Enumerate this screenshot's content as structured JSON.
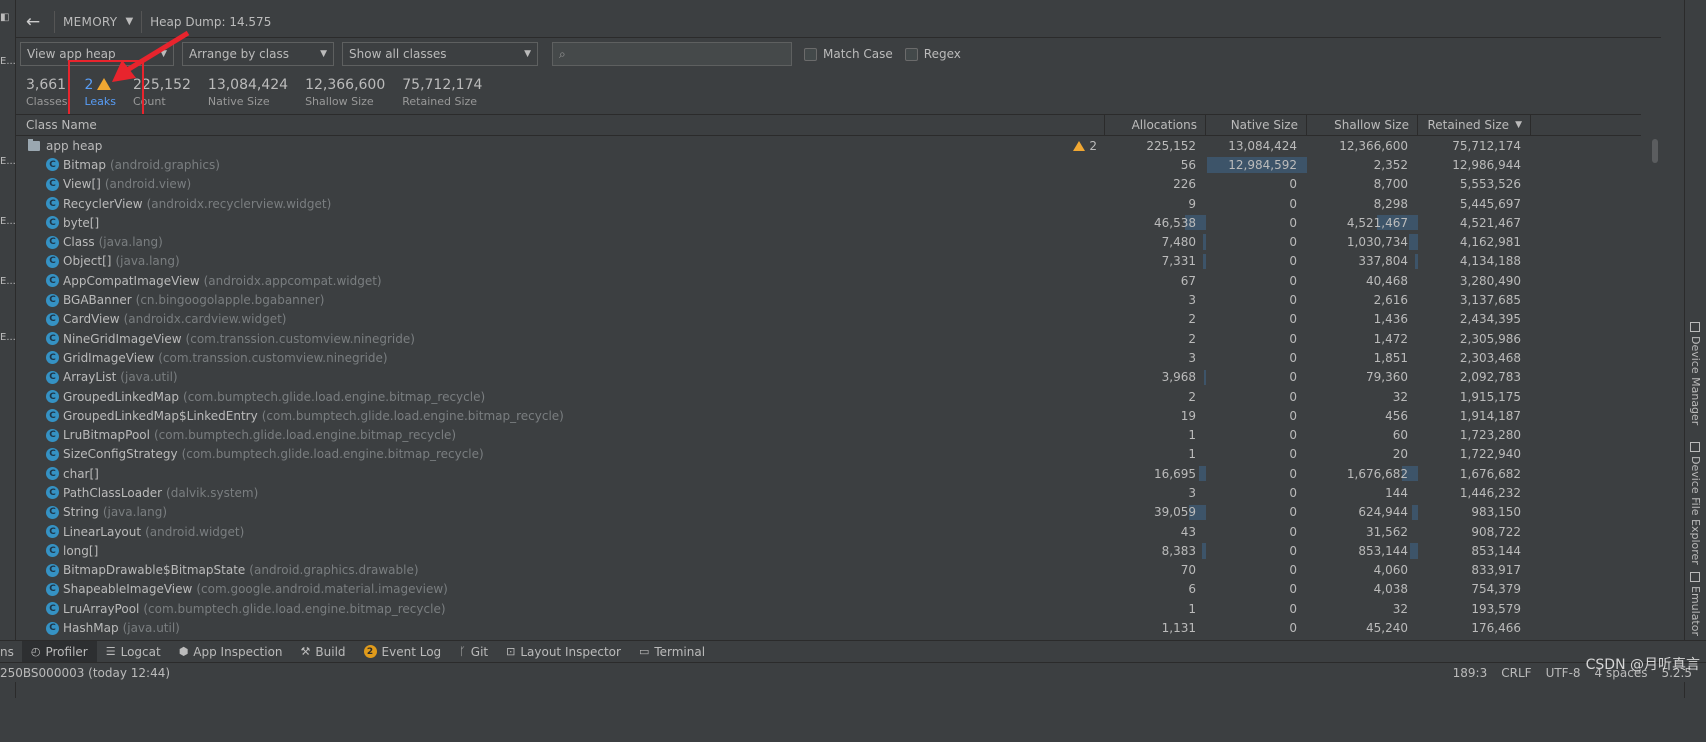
{
  "topbar": {
    "profiler_label": "MEMORY",
    "heap_dump_label": "Heap Dump: 14.575"
  },
  "filters": {
    "heap_select": "View app heap",
    "arrange_select": "Arrange by class",
    "show_select": "Show all classes",
    "search_placeholder": "",
    "match_case_label": "Match Case",
    "regex_label": "Regex"
  },
  "summary": {
    "classes": {
      "value": "3,661",
      "label": "Classes"
    },
    "leaks": {
      "value": "2",
      "label": "Leaks"
    },
    "count": {
      "value": "225,152",
      "label": "Count"
    },
    "native_size": {
      "value": "13,084,424",
      "label": "Native Size"
    },
    "shallow_size": {
      "value": "12,366,600",
      "label": "Shallow Size"
    },
    "retained_size": {
      "value": "75,712,174",
      "label": "Retained Size"
    }
  },
  "table": {
    "columns": [
      "Class Name",
      "Allocations",
      "Native Size",
      "Shallow Size",
      "Retained Size"
    ],
    "root": {
      "name": "app heap",
      "leaks": "2",
      "allocations": "225,152",
      "native": "13,084,424",
      "shallow": "12,366,600",
      "retained": "75,712,174"
    },
    "rows": [
      {
        "name": "Bitmap",
        "pkg": "(android.graphics)",
        "allocations": "56",
        "native": "12,984,592",
        "shallow": "2,352",
        "retained": "12,986,944",
        "native_bar": 0.99,
        "alloc_bar": 0,
        "shallow_bar": 0
      },
      {
        "name": "View[]",
        "pkg": "(android.view)",
        "allocations": "226",
        "native": "0",
        "shallow": "8,700",
        "retained": "5,553,526",
        "native_bar": 0,
        "alloc_bar": 0,
        "shallow_bar": 0
      },
      {
        "name": "RecyclerView",
        "pkg": "(androidx.recyclerview.widget)",
        "allocations": "9",
        "native": "0",
        "shallow": "8,298",
        "retained": "5,445,697",
        "native_bar": 0,
        "alloc_bar": 0,
        "shallow_bar": 0
      },
      {
        "name": "byte[]",
        "pkg": "",
        "allocations": "46,538",
        "native": "0",
        "shallow": "4,521,467",
        "retained": "4,521,467",
        "native_bar": 0,
        "alloc_bar": 0.21,
        "shallow_bar": 0.37
      },
      {
        "name": "Class",
        "pkg": "(java.lang)",
        "allocations": "7,480",
        "native": "0",
        "shallow": "1,030,734",
        "retained": "4,162,981",
        "native_bar": 0,
        "alloc_bar": 0.03,
        "shallow_bar": 0.08
      },
      {
        "name": "Object[]",
        "pkg": "(java.lang)",
        "allocations": "7,331",
        "native": "0",
        "shallow": "337,804",
        "retained": "4,134,188",
        "native_bar": 0,
        "alloc_bar": 0.03,
        "shallow_bar": 0.03
      },
      {
        "name": "AppCompatImageView",
        "pkg": "(androidx.appcompat.widget)",
        "allocations": "67",
        "native": "0",
        "shallow": "40,468",
        "retained": "3,280,490",
        "native_bar": 0,
        "alloc_bar": 0,
        "shallow_bar": 0
      },
      {
        "name": "BGABanner",
        "pkg": "(cn.bingoogolapple.bgabanner)",
        "allocations": "3",
        "native": "0",
        "shallow": "2,616",
        "retained": "3,137,685",
        "native_bar": 0,
        "alloc_bar": 0,
        "shallow_bar": 0
      },
      {
        "name": "CardView",
        "pkg": "(androidx.cardview.widget)",
        "allocations": "2",
        "native": "0",
        "shallow": "1,436",
        "retained": "2,434,395",
        "native_bar": 0,
        "alloc_bar": 0,
        "shallow_bar": 0
      },
      {
        "name": "NineGridImageView",
        "pkg": "(com.transsion.customview.ninegride)",
        "allocations": "2",
        "native": "0",
        "shallow": "1,472",
        "retained": "2,305,986",
        "native_bar": 0,
        "alloc_bar": 0,
        "shallow_bar": 0
      },
      {
        "name": "GridImageView",
        "pkg": "(com.transsion.customview.ninegride)",
        "allocations": "3",
        "native": "0",
        "shallow": "1,851",
        "retained": "2,303,468",
        "native_bar": 0,
        "alloc_bar": 0,
        "shallow_bar": 0
      },
      {
        "name": "ArrayList",
        "pkg": "(java.util)",
        "allocations": "3,968",
        "native": "0",
        "shallow": "79,360",
        "retained": "2,092,783",
        "native_bar": 0,
        "alloc_bar": 0.02,
        "shallow_bar": 0
      },
      {
        "name": "GroupedLinkedMap",
        "pkg": "(com.bumptech.glide.load.engine.bitmap_recycle)",
        "allocations": "2",
        "native": "0",
        "shallow": "32",
        "retained": "1,915,175",
        "native_bar": 0,
        "alloc_bar": 0,
        "shallow_bar": 0
      },
      {
        "name": "GroupedLinkedMap$LinkedEntry",
        "pkg": "(com.bumptech.glide.load.engine.bitmap_recycle)",
        "allocations": "19",
        "native": "0",
        "shallow": "456",
        "retained": "1,914,187",
        "native_bar": 0,
        "alloc_bar": 0,
        "shallow_bar": 0
      },
      {
        "name": "LruBitmapPool",
        "pkg": "(com.bumptech.glide.load.engine.bitmap_recycle)",
        "allocations": "1",
        "native": "0",
        "shallow": "60",
        "retained": "1,723,280",
        "native_bar": 0,
        "alloc_bar": 0,
        "shallow_bar": 0
      },
      {
        "name": "SizeConfigStrategy",
        "pkg": "(com.bumptech.glide.load.engine.bitmap_recycle)",
        "allocations": "1",
        "native": "0",
        "shallow": "20",
        "retained": "1,722,940",
        "native_bar": 0,
        "alloc_bar": 0,
        "shallow_bar": 0
      },
      {
        "name": "char[]",
        "pkg": "",
        "allocations": "16,695",
        "native": "0",
        "shallow": "1,676,682",
        "retained": "1,676,682",
        "native_bar": 0,
        "alloc_bar": 0.07,
        "shallow_bar": 0.14
      },
      {
        "name": "PathClassLoader",
        "pkg": "(dalvik.system)",
        "allocations": "3",
        "native": "0",
        "shallow": "144",
        "retained": "1,446,232",
        "native_bar": 0,
        "alloc_bar": 0,
        "shallow_bar": 0
      },
      {
        "name": "String",
        "pkg": "(java.lang)",
        "allocations": "39,059",
        "native": "0",
        "shallow": "624,944",
        "retained": "983,150",
        "native_bar": 0,
        "alloc_bar": 0.17,
        "shallow_bar": 0.05
      },
      {
        "name": "LinearLayout",
        "pkg": "(android.widget)",
        "allocations": "43",
        "native": "0",
        "shallow": "31,562",
        "retained": "908,722",
        "native_bar": 0,
        "alloc_bar": 0,
        "shallow_bar": 0
      },
      {
        "name": "long[]",
        "pkg": "",
        "allocations": "8,383",
        "native": "0",
        "shallow": "853,144",
        "retained": "853,144",
        "native_bar": 0,
        "alloc_bar": 0.04,
        "shallow_bar": 0.07
      },
      {
        "name": "BitmapDrawable$BitmapState",
        "pkg": "(android.graphics.drawable)",
        "allocations": "70",
        "native": "0",
        "shallow": "4,060",
        "retained": "833,917",
        "native_bar": 0,
        "alloc_bar": 0,
        "shallow_bar": 0
      },
      {
        "name": "ShapeableImageView",
        "pkg": "(com.google.android.material.imageview)",
        "allocations": "6",
        "native": "0",
        "shallow": "4,038",
        "retained": "754,379",
        "native_bar": 0,
        "alloc_bar": 0,
        "shallow_bar": 0
      },
      {
        "name": "LruArrayPool",
        "pkg": "(com.bumptech.glide.load.engine.bitmap_recycle)",
        "allocations": "1",
        "native": "0",
        "shallow": "32",
        "retained": "193,579",
        "native_bar": 0,
        "alloc_bar": 0,
        "shallow_bar": 0
      },
      {
        "name": "HashMap",
        "pkg": "(java.util)",
        "allocations": "1,131",
        "native": "0",
        "shallow": "45,240",
        "retained": "176,466",
        "native_bar": 0,
        "alloc_bar": 0,
        "shallow_bar": 0
      }
    ]
  },
  "tool_windows": [
    {
      "id": "profiler",
      "label": "Profiler",
      "icon": "profiler-icon",
      "glyph": "◴",
      "active": true
    },
    {
      "id": "logcat",
      "label": "Logcat",
      "icon": "logcat-icon",
      "glyph": "☰",
      "active": false
    },
    {
      "id": "app-inspection",
      "label": "App Inspection",
      "icon": "app-inspection-icon",
      "glyph": "⬢",
      "active": false
    },
    {
      "id": "build",
      "label": "Build",
      "icon": "build-icon",
      "glyph": "⚒",
      "active": false
    },
    {
      "id": "event-log",
      "label": "Event Log",
      "icon": "event-log-icon",
      "glyph": "",
      "badge": "2",
      "active": false
    },
    {
      "id": "git",
      "label": "Git",
      "icon": "git-icon",
      "glyph": "ᚴ",
      "active": false
    },
    {
      "id": "layout-inspector",
      "label": "Layout Inspector",
      "icon": "layout-inspector-icon",
      "glyph": "⊡",
      "active": false
    },
    {
      "id": "terminal",
      "label": "Terminal",
      "icon": "terminal-icon",
      "glyph": "▭",
      "active": false
    }
  ],
  "bottom_fragment_left": "ns",
  "status": {
    "device": "250BS000003 (today 12:44)",
    "position": "189:3",
    "line_sep": "CRLF",
    "encoding": "UTF-8",
    "indent": "4 spaces",
    "version_fragment": "5.2.5"
  },
  "watermark": "CSDN @月听真言",
  "side_tabs": [
    "Device Manager",
    "Device File Explorer",
    "Emulator"
  ],
  "left_fragments": [
    "E...",
    "E...",
    "E...",
    "E...",
    "E..."
  ],
  "colors": {
    "panel_bg": "#3c3f41",
    "accent_blue": "#589df6",
    "warning": "#f0a732",
    "annotation_red": "#e8242d",
    "class_icon": "#3592c4",
    "bar_fill": "#3d5469"
  }
}
